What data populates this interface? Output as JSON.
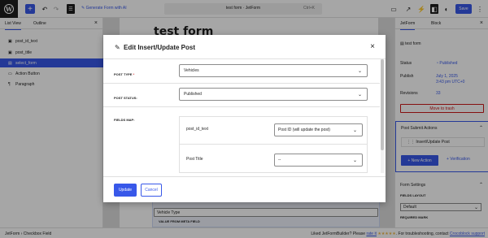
{
  "toolbar": {
    "add_icon": "plus-icon",
    "generate_ai": "Generate Form with AI",
    "doc_title": "test form · JetForm",
    "shortcut": "Ctrl+K",
    "save_label": "Save"
  },
  "left_panel": {
    "tabs": [
      "List View",
      "Outline"
    ],
    "items": [
      {
        "label": "post_id_text",
        "icon": "field-icon"
      },
      {
        "label": "post_title",
        "icon": "field-icon"
      },
      {
        "label": "select_form",
        "icon": "select-icon"
      },
      {
        "label": "Action Button",
        "icon": "action-icon"
      },
      {
        "label": "Paragraph",
        "icon": "paragraph-icon"
      }
    ]
  },
  "canvas": {
    "title": "test form",
    "bg_label_1": "FILL OPTIONS FROM",
    "bg_field_1": "Vehicle Type",
    "bg_label_2": "VALUE FROM META FIELD"
  },
  "right_panel": {
    "tabs": [
      "JetForm",
      "Block"
    ],
    "form_name": "test form",
    "status_label": "Status",
    "status_value": "Published",
    "publish_label": "Publish",
    "publish_value_1": "July 1, 2025",
    "publish_value_2": "3:43 pm UTC+0",
    "revisions_label": "Revisions",
    "revisions_value": "33",
    "trash_label": "Move to trash",
    "psa_title": "Post Submit Actions",
    "psa_item": "Insert/Update Post",
    "new_action": "+ New Action",
    "verification": "+ Verification",
    "form_settings": "Form Settings",
    "fields_layout_label": "FIELDS LAYOUT",
    "fields_layout_value": "Default",
    "required_mark_label": "REQUIRED MARK"
  },
  "modal": {
    "title": "Edit Insert/Update Post",
    "post_type_label": "POST TYPE",
    "post_type_required": "*",
    "post_type_value": "Vehicles",
    "post_status_label": "POST STATUS:",
    "post_status_value": "Published",
    "fields_map_label": "FIELDS MAP:",
    "map_rows": [
      {
        "field": "post_id_text",
        "value": "Post ID (will update the post)"
      },
      {
        "field": "Post Title",
        "value": "--"
      }
    ],
    "update_label": "Update",
    "cancel_label": "Cancel"
  },
  "statusbar": {
    "crumb_1": "JetForm",
    "crumb_sep": "›",
    "crumb_2": "Checkbox Field",
    "footer_pre": "Liked JetFormBuilder? Please",
    "footer_rate": "rate it",
    "footer_stars": "★★★★★",
    "footer_mid": ". For troubleshooting, contact",
    "footer_link": "Crocoblock support"
  }
}
